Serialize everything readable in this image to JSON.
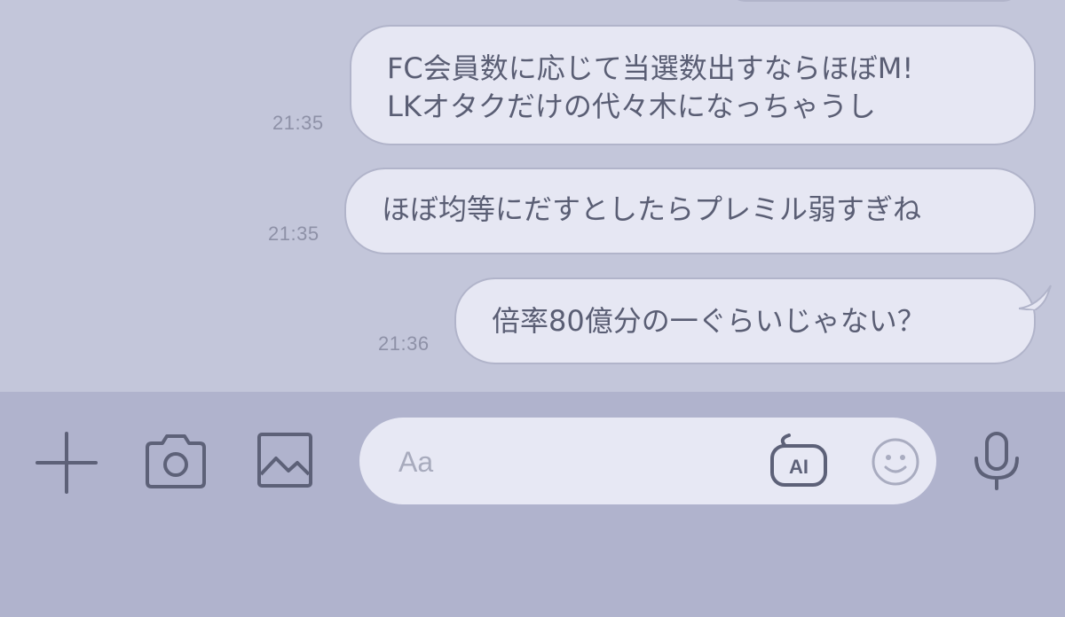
{
  "messages": [
    {
      "lines": [
        "FC会員数に応じて当選数出すならほぼM!",
        "LKオタクだけの代々木になっちゃうし"
      ],
      "time": "21:35"
    },
    {
      "lines": [
        "ほぼ均等にだすとしたらプレミル弱すぎね"
      ],
      "time": "21:35"
    },
    {
      "lines": [
        "倍率80億分の一ぐらいじゃない？"
      ],
      "time": "21:36"
    }
  ],
  "input_bar": {
    "placeholder": "Aa",
    "ai_label": "AI",
    "icons": [
      "plus-icon",
      "camera-icon",
      "image-icon",
      "ai-icon",
      "emoji-icon",
      "mic-icon"
    ]
  },
  "colors": {
    "chat_background": "#c3c6da",
    "bubble_fill": "#e6e7f3",
    "bubble_border": "#b1b4ca",
    "text": "#5a5e74",
    "timestamp": "#8e91a7",
    "input_bar": "#b0b3cd",
    "icon": "#5d6178"
  }
}
